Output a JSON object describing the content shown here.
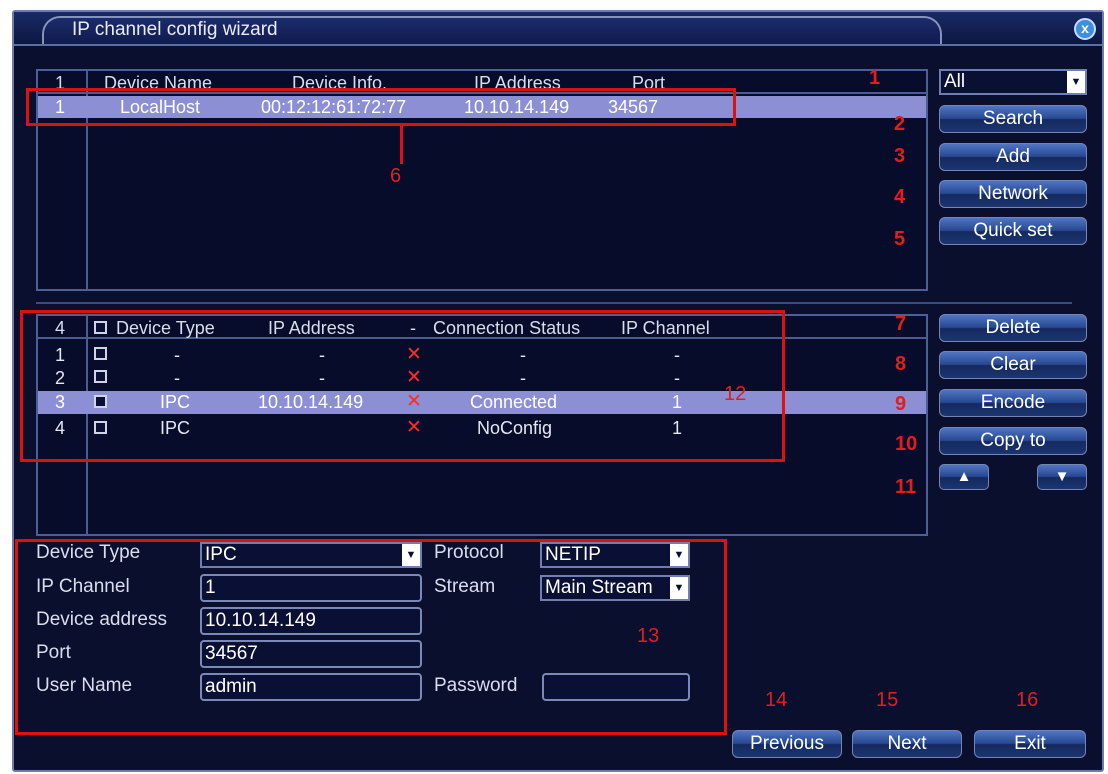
{
  "window": {
    "title": "IP channel config wizard",
    "close_glyph": "x"
  },
  "search_list": {
    "headers": [
      "1",
      "Device Name",
      "Device Info.",
      "IP Address",
      "Port"
    ],
    "rows": [
      {
        "index": "1",
        "name": "LocalHost",
        "info": "00:12:12:61:72:77",
        "ip": "10.10.14.149",
        "port": "34567"
      }
    ]
  },
  "filter_select": {
    "value": "All"
  },
  "right_buttons_top": {
    "search": "Search",
    "add": "Add",
    "network": "Network",
    "quick_set": "Quick set"
  },
  "channel_list": {
    "headers": {
      "count": "4",
      "device_type": "Device Type",
      "ip": "IP Address",
      "dash": "-",
      "status": "Connection Status",
      "channel": "IP Channel"
    },
    "rows": [
      {
        "index": "1",
        "type": "-",
        "ip": "-",
        "status": "-",
        "channel": "-"
      },
      {
        "index": "2",
        "type": "-",
        "ip": "-",
        "status": "-",
        "channel": "-"
      },
      {
        "index": "3",
        "type": "IPC",
        "ip": "10.10.14.149",
        "status": "Connected",
        "channel": "1"
      },
      {
        "index": "4",
        "type": "IPC",
        "ip": "",
        "status": "NoConfig",
        "channel": "1"
      }
    ]
  },
  "right_buttons_bottom": {
    "delete": "Delete",
    "clear": "Clear",
    "encode": "Encode",
    "copy_to": "Copy to",
    "up": "▲",
    "down": "▼"
  },
  "form": {
    "device_type_label": "Device Type",
    "device_type_value": "IPC",
    "protocol_label": "Protocol",
    "protocol_value": "NETIP",
    "ip_channel_label": "IP Channel",
    "ip_channel_value": "1",
    "stream_label": "Stream",
    "stream_value": "Main Stream",
    "device_address_label": "Device address",
    "device_address_value": "10.10.14.149",
    "port_label": "Port",
    "port_value": "34567",
    "user_name_label": "User Name",
    "user_name_value": "admin",
    "password_label": "Password",
    "password_value": ""
  },
  "bottom_buttons": {
    "previous": "Previous",
    "next": "Next",
    "exit": "Exit"
  },
  "annotations": {
    "a1": "1",
    "a2": "2",
    "a3": "3",
    "a4": "4",
    "a5": "5",
    "a6": "6",
    "a7": "7",
    "a8": "8",
    "a9": "9",
    "a10": "10",
    "a11": "11",
    "a12": "12",
    "a13": "13",
    "a14": "14",
    "a15": "15",
    "a16": "16"
  }
}
